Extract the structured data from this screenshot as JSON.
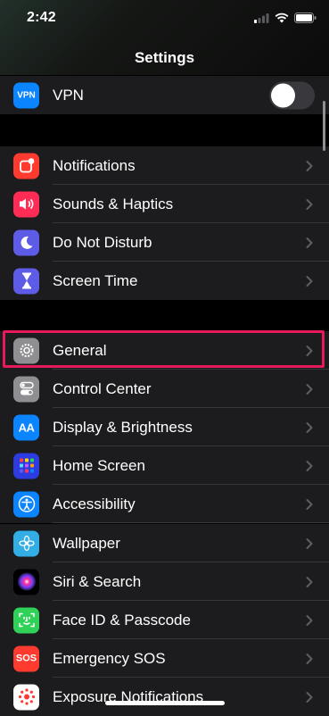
{
  "status_bar": {
    "time": "2:42"
  },
  "header": {
    "title": "Settings"
  },
  "vpn": {
    "icon": "VPN",
    "label": "VPN",
    "toggle_on": false
  },
  "group1": [
    {
      "label": "Notifications",
      "icon": "notifications-icon",
      "color": "#ff3b30"
    },
    {
      "label": "Sounds & Haptics",
      "icon": "speaker-icon",
      "color": "#ff2d55"
    },
    {
      "label": "Do Not Disturb",
      "icon": "moon-icon",
      "color": "#5e5ce6"
    },
    {
      "label": "Screen Time",
      "icon": "hourglass-icon",
      "color": "#5e5ce6"
    }
  ],
  "group2": [
    {
      "label": "General",
      "icon": "gear-icon",
      "color": "#8e8e93"
    },
    {
      "label": "Control Center",
      "icon": "toggles-icon",
      "color": "#8e8e93"
    },
    {
      "label": "Display & Brightness",
      "icon": "AA",
      "color": "#0a84ff"
    },
    {
      "label": "Home Screen",
      "icon": "app-grid-icon",
      "color": "#2c3ce0"
    },
    {
      "label": "Accessibility",
      "icon": "accessibility-icon",
      "color": "#0a84ff"
    },
    {
      "label": "Wallpaper",
      "icon": "flower-icon",
      "color": "#32ade6"
    },
    {
      "label": "Siri & Search",
      "icon": "siri-icon",
      "color": "#1c1c1e"
    },
    {
      "label": "Face ID & Passcode",
      "icon": "face-id-icon",
      "color": "#30d158"
    },
    {
      "label": "Emergency SOS",
      "icon": "SOS",
      "color": "#ff3b30"
    },
    {
      "label": "Exposure Notifications",
      "icon": "exposure-icon",
      "color": "#ffffff"
    }
  ],
  "highlight_color": "#e41a5b"
}
